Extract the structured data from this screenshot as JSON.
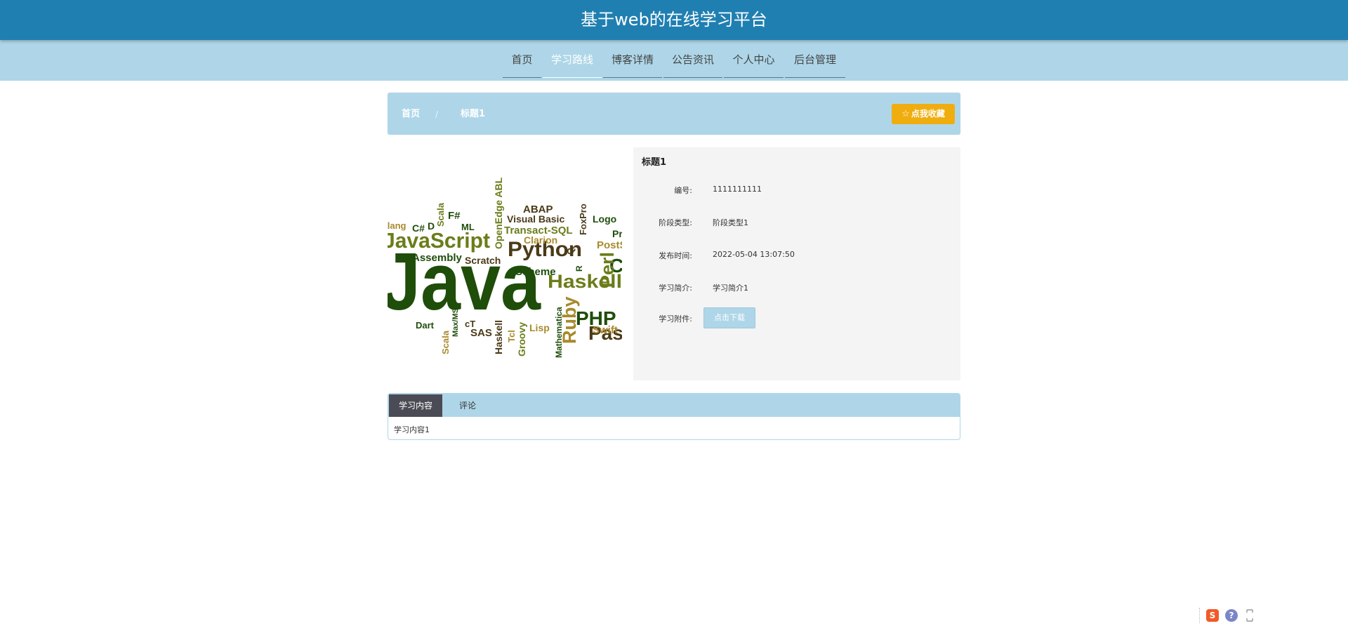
{
  "header": {
    "site_title": "基于web的在线学习平台"
  },
  "nav": {
    "items": [
      {
        "label": "首页"
      },
      {
        "label": "学习路线",
        "active": true
      },
      {
        "label": "博客详情"
      },
      {
        "label": "公告资讯"
      },
      {
        "label": "个人中心"
      },
      {
        "label": "后台管理"
      }
    ]
  },
  "breadcrumb": {
    "home": "首页",
    "separator": "/",
    "current": "标题1",
    "favorite_label": "点我收藏",
    "favorite_icon": "star-icon"
  },
  "detail": {
    "title": "标题1",
    "fields": [
      {
        "label": "编号:",
        "value": "1111111111"
      },
      {
        "label": "阶段类型:",
        "value": "阶段类型1"
      },
      {
        "label": "发布时间:",
        "value": "2022-05-04 13:07:50"
      },
      {
        "label": "学习简介:",
        "value": "学习简介1"
      }
    ],
    "attachment_label": "学习附件:",
    "download_label": "点击下载"
  },
  "cover_image": {
    "words": [
      "Java",
      "JavaScript",
      "Python",
      "Haskell",
      "Ruby",
      "PHP",
      "Pascal",
      "Perl",
      "Visual Basic",
      "Transact-SQL",
      "ABAP",
      "Clarion",
      "OpenEdge ABL",
      "FoxPro",
      "Scala",
      "F#",
      "ML",
      "C#",
      "D",
      "Erlang",
      "Assembly",
      "Scratch",
      "Scheme",
      "Q",
      "R",
      "C",
      "Lisp",
      "Swift",
      "Groovy",
      "Tcl",
      "Mathematica",
      "Dart",
      "Max/MSP",
      "cT",
      "SAS",
      "Haskell",
      "Scala",
      "Logo",
      "Prolog",
      "PostScript"
    ],
    "colors": {
      "dark": "#1f4d0a",
      "olive": "#6a7d1a",
      "gold": "#a88a2c",
      "brown": "#4a3a18"
    }
  },
  "tabs": [
    {
      "label": "学习内容",
      "active": true
    },
    {
      "label": "评论",
      "active": false
    }
  ],
  "tab_content": "学习内容1",
  "tray": {
    "sogou_glyph": "S",
    "help_glyph": "?"
  },
  "colors": {
    "header_bg": "#207fb1",
    "nav_bg": "#aed6e8",
    "favorite_bg": "#f0ad0f",
    "tab_active_bg": "#4b4b55",
    "panel_bg": "#f4f4f4"
  }
}
